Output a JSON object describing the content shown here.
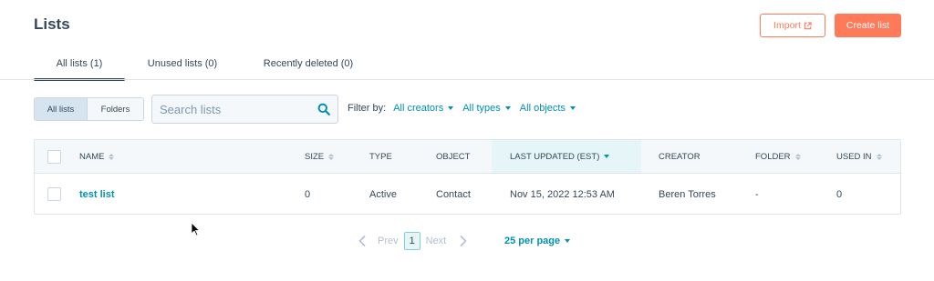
{
  "header": {
    "title": "Lists",
    "import_label": "Import",
    "create_label": "Create list"
  },
  "tabs": [
    {
      "label": "All lists (1)",
      "active": true
    },
    {
      "label": "Unused lists (0)",
      "active": false
    },
    {
      "label": "Recently deleted (0)",
      "active": false
    }
  ],
  "view_toggle": {
    "all_lists": "All lists",
    "folders": "Folders",
    "selected": "All lists"
  },
  "search": {
    "placeholder": "Search lists",
    "value": ""
  },
  "filters": {
    "label": "Filter by:",
    "creators": "All creators",
    "types": "All types",
    "objects": "All objects"
  },
  "table": {
    "columns": [
      "NAME",
      "SIZE",
      "TYPE",
      "OBJECT",
      "LAST UPDATED (EST)",
      "CREATOR",
      "FOLDER",
      "USED IN"
    ],
    "sorted_column": "LAST UPDATED (EST)",
    "rows": [
      {
        "name": "test list",
        "size": "0",
        "type": "Active",
        "object": "Contact",
        "last_updated": "Nov 15, 2022 12:53 AM",
        "creator": "Beren Torres",
        "folder": "-",
        "used_in": "0"
      }
    ]
  },
  "pagination": {
    "prev": "Prev",
    "current_page": "1",
    "next": "Next",
    "per_page": "25 per page"
  },
  "colors": {
    "accent": "#ff7a59",
    "link": "#0091ae",
    "text": "#33475b"
  }
}
